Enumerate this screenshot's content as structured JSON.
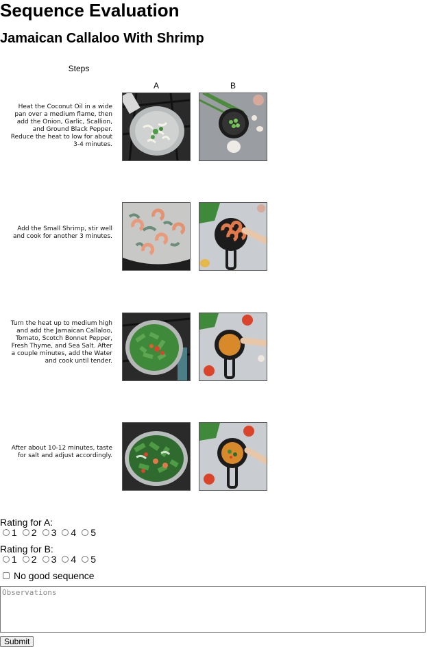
{
  "page": {
    "title": "Sequence Evaluation",
    "recipe_title": "Jamaican Callaloo With Shrimp",
    "steps_header": "Steps",
    "column_a_label": "A",
    "column_b_label": "B"
  },
  "steps": [
    {
      "text": "Heat the Coconut Oil in a wide pan over a medium flame, then add the Onion, Garlic, Scallion, and Ground Black Pepper. Reduce the heat to low for about 3-4 minutes."
    },
    {
      "text": "Add the Small Shrimp, stir well and cook for another 3 minutes."
    },
    {
      "text": "Turn the heat up to medium high and add the Jamaican Callaloo, Tomato, Scotch Bonnet Pepper, Fresh Thyme, and Sea Salt. After a couple minutes, add the Water and cook until tender."
    },
    {
      "text": "After about 10-12 minutes, taste for salt and adjust accordingly."
    }
  ],
  "ratings": {
    "a_label": "Rating for A:",
    "b_label": "Rating for B:",
    "options": [
      "1",
      "2",
      "3",
      "4",
      "5"
    ]
  },
  "no_good_label": "No good sequence",
  "observations_placeholder": "Observations",
  "submit_label": "Submit",
  "colors": {
    "pan_silver": "#b9bcbc",
    "stove_dark": "#2a2a2a",
    "skillet_black": "#1c1c1c",
    "marble": "#c9ccd0",
    "greens": "#3f8a3a",
    "shrimp": "#e07a4a",
    "tomato": "#d9442b",
    "curry": "#d8892a"
  }
}
